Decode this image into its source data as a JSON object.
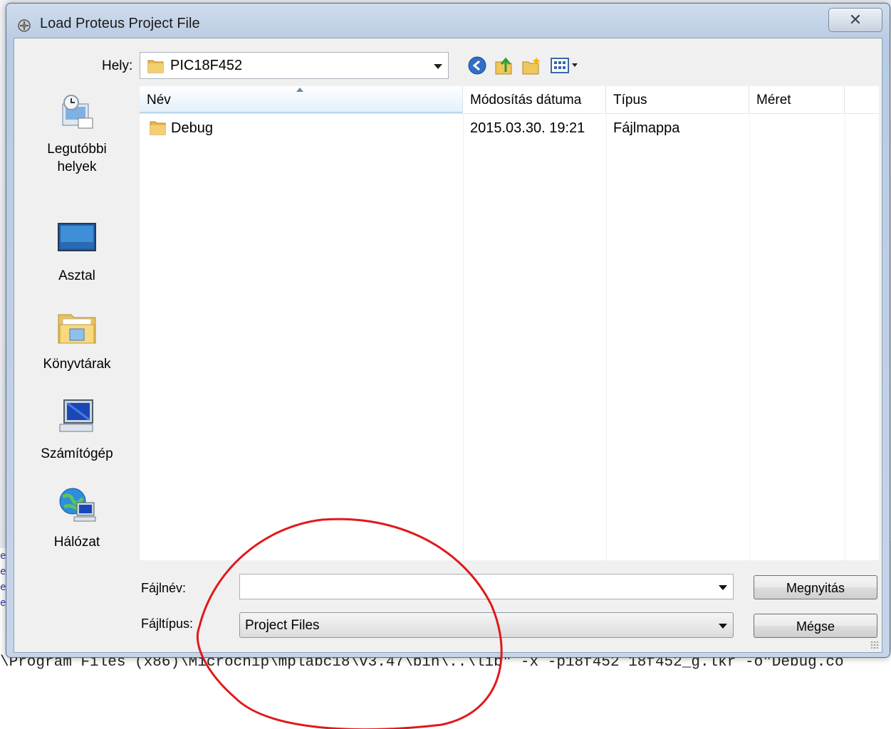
{
  "window": {
    "title": "Load Proteus Project File",
    "close_symbol": "✕"
  },
  "location": {
    "label": "Hely:",
    "value": "PIC18F452"
  },
  "toolbar": {
    "icons": [
      "back-icon",
      "up-folder-icon",
      "new-folder-icon",
      "view-menu-icon"
    ]
  },
  "places": [
    {
      "label_line1": "Legutóbbi",
      "label_line2": "helyek",
      "icon": "recent-places-icon"
    },
    {
      "label_line1": "Asztal",
      "label_line2": "",
      "icon": "desktop-icon"
    },
    {
      "label_line1": "Könyvtárak",
      "label_line2": "",
      "icon": "libraries-icon"
    },
    {
      "label_line1": "Számítógép",
      "label_line2": "",
      "icon": "computer-icon"
    },
    {
      "label_line1": "Hálózat",
      "label_line2": "",
      "icon": "network-icon"
    }
  ],
  "file_list": {
    "columns": [
      "Név",
      "Módosítás dátuma",
      "Típus",
      "Méret"
    ],
    "rows": [
      {
        "name": "Debug",
        "modified": "2015.03.30. 19:21",
        "type": "Fájlmappa",
        "size": ""
      }
    ]
  },
  "form": {
    "filename_label": "Fájlnév:",
    "filename_value": "",
    "filetype_label": "Fájltípus:",
    "filetype_value": "Project Files",
    "open_button": "Megnyitás",
    "cancel_button": "Mégse"
  },
  "background": {
    "command_line": "\\Program Files (x86)\\Microchip\\mplabc18\\v3.47\\bin\\..\\lib\" -x -p18f452 18f452_g.lkr -o\"Debug.co",
    "left_letters": [
      "e",
      "e",
      "e",
      "e"
    ]
  },
  "colors": {
    "annotation": "#e0191b",
    "selection_header": "#e3f0fb",
    "folder": "#e8b84a"
  }
}
